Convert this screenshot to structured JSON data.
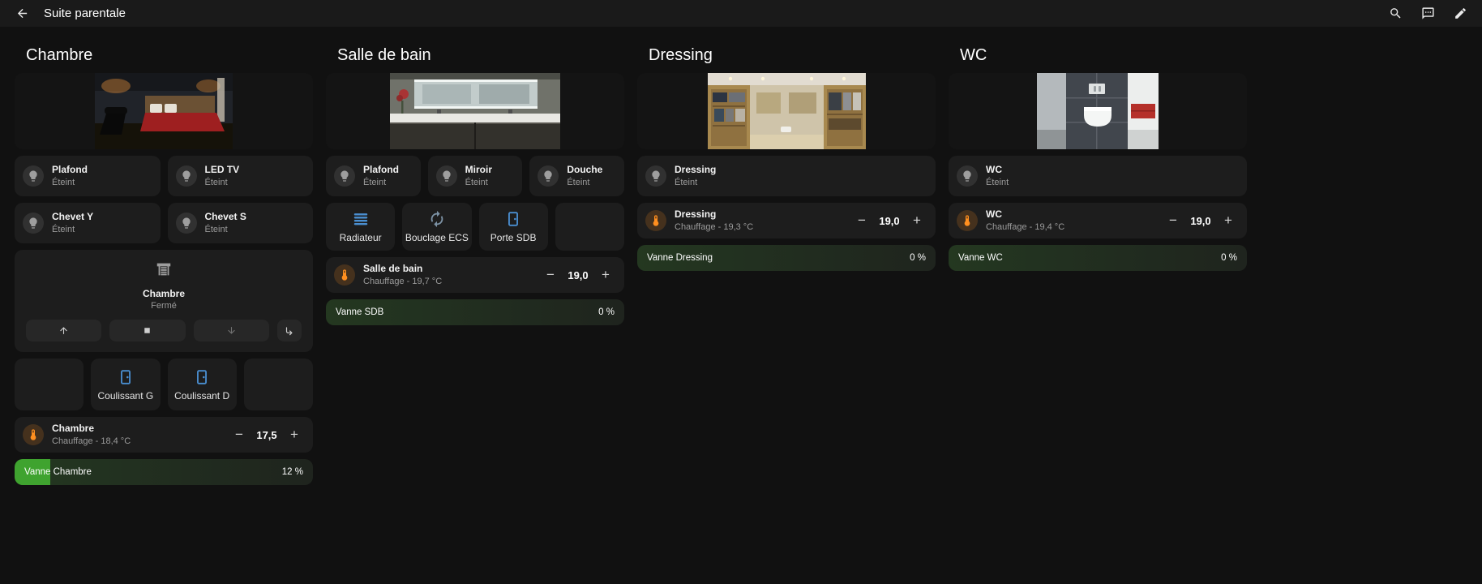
{
  "header": {
    "title": "Suite parentale"
  },
  "controls": {
    "minus": "−",
    "plus": "+"
  },
  "rooms": {
    "chambre": {
      "title": "Chambre",
      "lights": [
        {
          "name": "Plafond",
          "state": "Éteint"
        },
        {
          "name": "LED TV",
          "state": "Éteint"
        },
        {
          "name": "Chevet Y",
          "state": "Éteint"
        },
        {
          "name": "Chevet S",
          "state": "Éteint"
        }
      ],
      "cover": {
        "name": "Chambre",
        "state": "Fermé"
      },
      "doors": [
        {
          "label": "Coulissant G"
        },
        {
          "label": "Coulissant D"
        }
      ],
      "climate": {
        "name": "Chambre",
        "state": "Chauffage - 18,4 °C",
        "setpoint": "17,5"
      },
      "valve": {
        "name": "Vanne Chambre",
        "value": "12 %",
        "percent": 12
      }
    },
    "sdb": {
      "title": "Salle de bain",
      "lights": [
        {
          "name": "Plafond",
          "state": "Éteint"
        },
        {
          "name": "Miroir",
          "state": "Éteint"
        },
        {
          "name": "Douche",
          "state": "Éteint"
        }
      ],
      "buttons": [
        {
          "label": "Radiateur",
          "icon": "radiator"
        },
        {
          "label": "Bouclage ECS",
          "icon": "sync"
        },
        {
          "label": "Porte SDB",
          "icon": "door"
        }
      ],
      "climate": {
        "name": "Salle de bain",
        "state": "Chauffage - 19,7 °C",
        "setpoint": "19,0"
      },
      "valve": {
        "name": "Vanne SDB",
        "value": "0 %",
        "percent": 0
      }
    },
    "dressing": {
      "title": "Dressing",
      "lights": [
        {
          "name": "Dressing",
          "state": "Éteint"
        }
      ],
      "climate": {
        "name": "Dressing",
        "state": "Chauffage - 19,3 °C",
        "setpoint": "19,0"
      },
      "valve": {
        "name": "Vanne Dressing",
        "value": "0 %",
        "percent": 0
      }
    },
    "wc": {
      "title": "WC",
      "lights": [
        {
          "name": "WC",
          "state": "Éteint"
        }
      ],
      "climate": {
        "name": "WC",
        "state": "Chauffage - 19,4 °C",
        "setpoint": "19,0"
      },
      "valve": {
        "name": "Vanne WC",
        "value": "0 %",
        "percent": 0
      }
    }
  },
  "colors": {
    "background": "#111111",
    "card": "#1d1d1d",
    "accent_blue": "#4a8fd1",
    "climate_orange": "#ff8f1f",
    "valve_green": "#3fa32f"
  }
}
